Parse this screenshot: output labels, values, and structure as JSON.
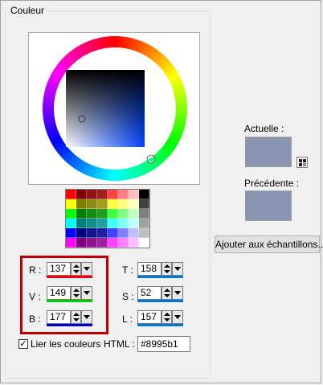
{
  "group_title": "Couleur",
  "palette": [
    [
      "#ff0000",
      "#7f0000",
      "#8c1414",
      "#a01e1e",
      "#ff4040",
      "#ff8080",
      "#ffbfbf",
      "#000000"
    ],
    [
      "#ffff00",
      "#7f7f00",
      "#8c8c14",
      "#a0a01e",
      "#ffff40",
      "#ffff80",
      "#ffffbf",
      "#3f3f3f"
    ],
    [
      "#00ff00",
      "#007f00",
      "#148c14",
      "#1ea01e",
      "#40ff40",
      "#80ff80",
      "#bfffbf",
      "#7f7f7f"
    ],
    [
      "#00ffff",
      "#007f7f",
      "#148c8c",
      "#1ea0a0",
      "#40ffff",
      "#80ffff",
      "#bfffff",
      "#9f9f9f"
    ],
    [
      "#0000ff",
      "#00007f",
      "#14148c",
      "#1e1ea0",
      "#4040ff",
      "#8080ff",
      "#bfbfff",
      "#bfbfbf"
    ],
    [
      "#ff00ff",
      "#7f007f",
      "#8c148c",
      "#a01ea0",
      "#ff40ff",
      "#ff80ff",
      "#ffbfff",
      "#ffffff"
    ]
  ],
  "fields": {
    "r": {
      "label": "R :",
      "value": "137",
      "bar": "#ff0000"
    },
    "v": {
      "label": "V :",
      "value": "149",
      "bar": "#00cc00"
    },
    "b": {
      "label": "B :",
      "value": "177",
      "bar": "#0000cc"
    },
    "t": {
      "label": "T :",
      "value": "158",
      "bar": "#0078d7"
    },
    "s": {
      "label": "S :",
      "value": "52",
      "bar": "#0078d7"
    },
    "l": {
      "label": "L :",
      "value": "157",
      "bar": "#0078d7"
    }
  },
  "link_colors": {
    "label": "Lier les couleurs",
    "checked": true,
    "check_mark": "✓"
  },
  "html": {
    "label": "HTML :",
    "value": "#8995b1"
  },
  "current": {
    "label": "Actuelle :",
    "color": "#8995b1"
  },
  "previous": {
    "label": "Précédente :",
    "color": "#8995b1"
  },
  "add_button": "Ajouter aux échantillons..."
}
